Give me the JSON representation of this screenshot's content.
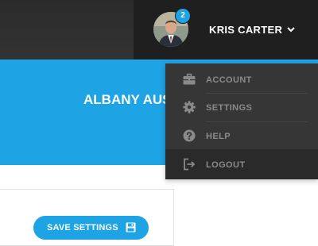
{
  "header": {
    "user": {
      "name": "KRIS CARTER",
      "notification_count": "2",
      "avatar_icon": "user-avatar",
      "menu_toggle_icon": "chevron-down-icon"
    }
  },
  "hero": {
    "title": "ALBANY AUS"
  },
  "user_menu": {
    "items": [
      {
        "label": "ACCOUNT",
        "icon": "briefcase-icon"
      },
      {
        "label": "SETTINGS",
        "icon": "gear-icon"
      },
      {
        "label": "HELP",
        "icon": "question-circle-icon"
      },
      {
        "label": "LOGOUT",
        "icon": "logout-icon"
      }
    ]
  },
  "form": {
    "save_label": "SAVE SETTINGS",
    "save_icon": "floppy-disk-icon"
  },
  "colors": {
    "accent": "#1ea3e4",
    "topbar": "#2f2f2f",
    "user_area": "#1f1f1f",
    "menu_bg": "#363636",
    "menu_text": "#8a8a8a"
  }
}
